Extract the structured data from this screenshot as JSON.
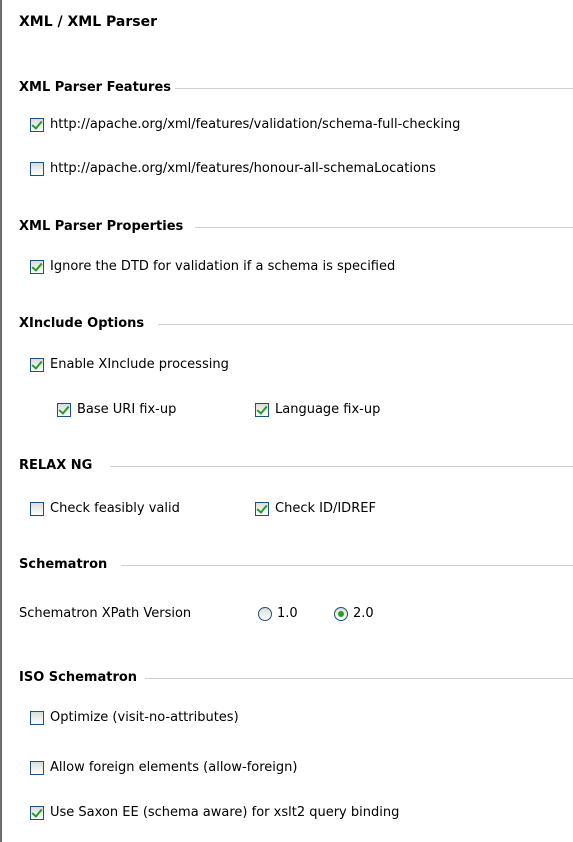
{
  "page_title": "XML / XML Parser",
  "sections": {
    "parser_features": {
      "title": "XML Parser Features",
      "items": [
        {
          "label": "http://apache.org/xml/features/validation/schema-full-checking",
          "checked": true
        },
        {
          "label": "http://apache.org/xml/features/honour-all-schemaLocations",
          "checked": false
        }
      ]
    },
    "parser_properties": {
      "title": "XML Parser Properties",
      "items": [
        {
          "label": "Ignore the DTD for validation if a schema is specified",
          "checked": true
        }
      ]
    },
    "xinclude": {
      "title": "XInclude Options",
      "enable": {
        "label": "Enable XInclude processing",
        "checked": true
      },
      "base_uri": {
        "label": "Base URI fix-up",
        "checked": true
      },
      "language": {
        "label": "Language fix-up",
        "checked": true
      }
    },
    "relaxng": {
      "title": "RELAX NG",
      "feasibly": {
        "label": "Check feasibly valid",
        "checked": false
      },
      "idref": {
        "label": "Check ID/IDREF",
        "checked": true
      }
    },
    "schematron": {
      "title": "Schematron",
      "version_label": "Schematron XPath Version",
      "options": [
        {
          "label": "1.0",
          "selected": false
        },
        {
          "label": "2.0",
          "selected": true
        }
      ]
    },
    "iso_schematron": {
      "title": "ISO Schematron",
      "items": [
        {
          "label": "Optimize (visit-no-attributes)",
          "checked": false
        },
        {
          "label": "Allow foreign elements (allow-foreign)",
          "checked": false
        },
        {
          "label": "Use Saxon EE (schema aware) for xslt2 query binding",
          "checked": true
        }
      ]
    }
  },
  "colors": {
    "check": "#21a121",
    "control_border": "#1c5180",
    "separator": "#cfcfcf"
  }
}
